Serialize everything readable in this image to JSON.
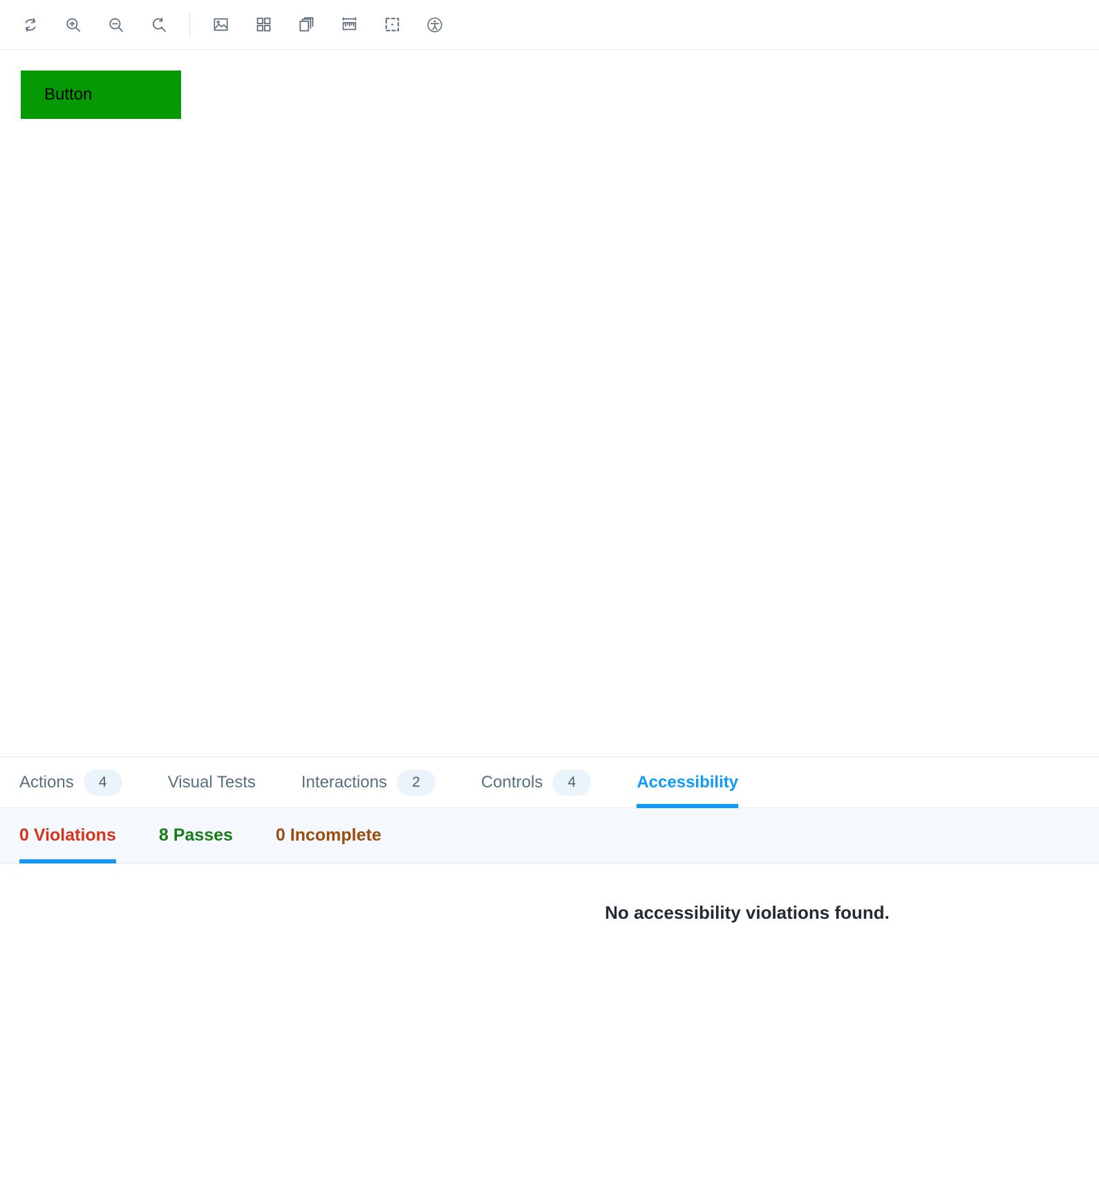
{
  "toolbar": {
    "items": [
      {
        "name": "remount-icon",
        "title": "Remount component"
      },
      {
        "name": "zoom-in-icon",
        "title": "Zoom in"
      },
      {
        "name": "zoom-out-icon",
        "title": "Zoom out"
      },
      {
        "name": "zoom-reset-icon",
        "title": "Reset zoom"
      },
      {
        "name": "background-image-icon",
        "title": "Change background"
      },
      {
        "name": "grid-icon",
        "title": "Apply a grid to the preview"
      },
      {
        "name": "viewport-icon",
        "title": "Change the size of the preview"
      },
      {
        "name": "measure-icon",
        "title": "Enable measure"
      },
      {
        "name": "outline-icon",
        "title": "Apply outlines to the preview"
      },
      {
        "name": "accessibility-icon",
        "title": "Vision simulator"
      }
    ]
  },
  "canvas": {
    "button_label": "Button",
    "button_color": "#059a05",
    "button_text_color": "#000000"
  },
  "panel": {
    "tabs": [
      {
        "label": "Actions",
        "count": "4",
        "active": false
      },
      {
        "label": "Visual Tests",
        "count": null,
        "active": false
      },
      {
        "label": "Interactions",
        "count": "2",
        "active": false
      },
      {
        "label": "Controls",
        "count": "4",
        "active": false
      },
      {
        "label": "Accessibility",
        "count": null,
        "active": true
      }
    ],
    "accent_color": "#0d9bfb"
  },
  "accessibility": {
    "subtabs": [
      {
        "label": "0 Violations",
        "color": "#d6341a",
        "active": true
      },
      {
        "label": "8 Passes",
        "color": "#167d16",
        "active": false
      },
      {
        "label": "0 Incomplete",
        "color": "#9a4d0c",
        "active": false
      }
    ],
    "empty_message": "No accessibility violations found."
  }
}
